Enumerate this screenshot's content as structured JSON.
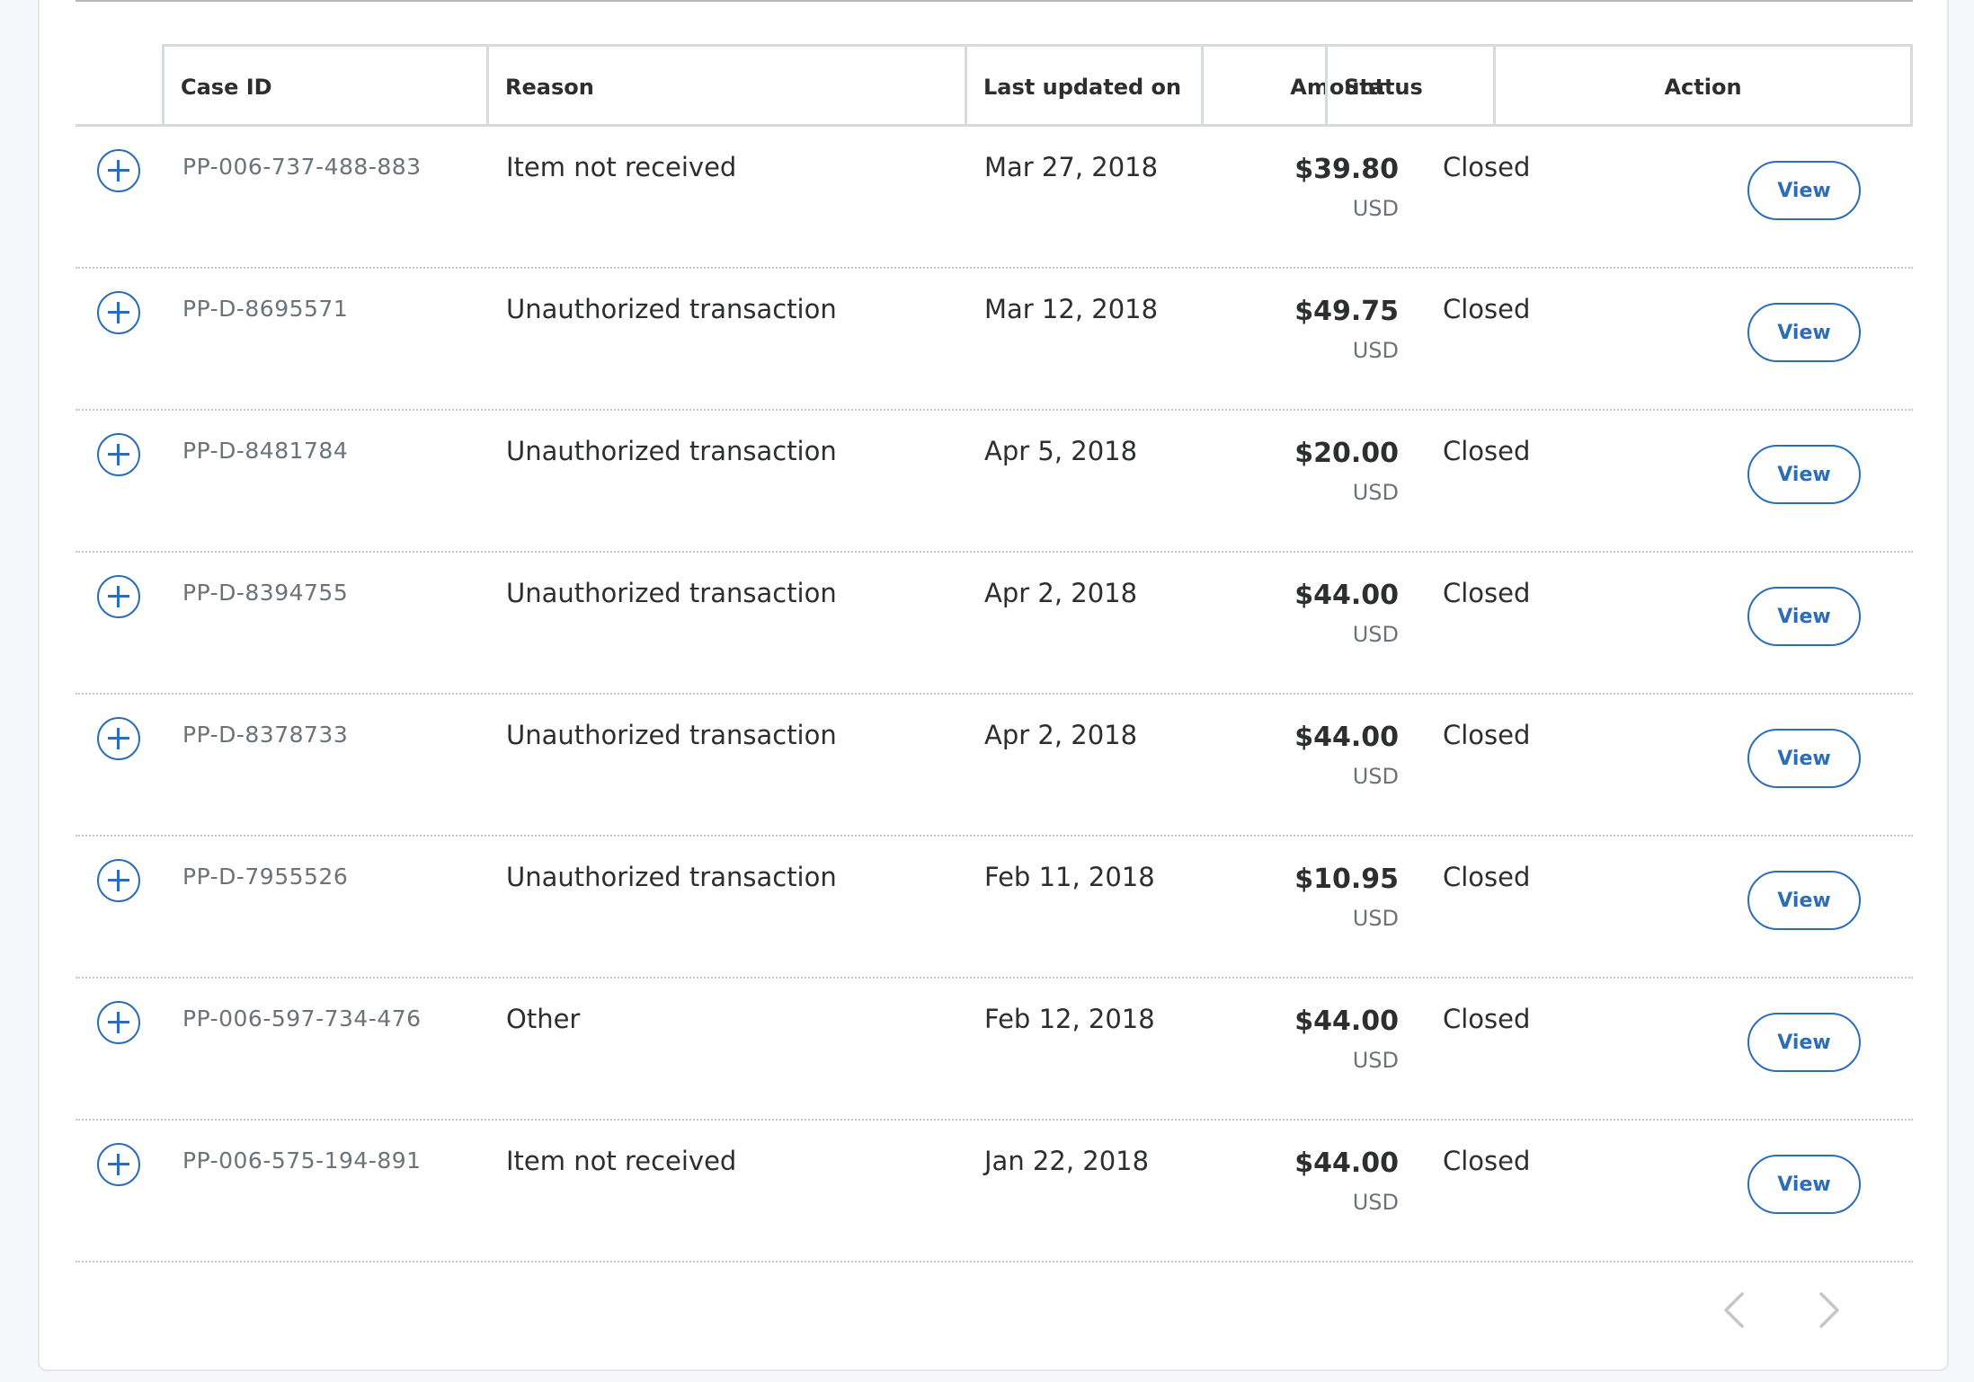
{
  "table": {
    "columns": {
      "case_id": "Case ID",
      "reason": "Reason",
      "last_updated": "Last updated on",
      "amount": "Amount",
      "status": "Status",
      "action": "Action"
    },
    "rows": [
      {
        "case_id": "PP-006-737-488-883",
        "reason": "Item not received",
        "last_updated": "Mar 27, 2018",
        "amount": "$39.80",
        "currency": "USD",
        "status": "Closed",
        "action_label": "View"
      },
      {
        "case_id": "PP-D-8695571",
        "reason": "Unauthorized transaction",
        "last_updated": "Mar 12, 2018",
        "amount": "$49.75",
        "currency": "USD",
        "status": "Closed",
        "action_label": "View"
      },
      {
        "case_id": "PP-D-8481784",
        "reason": "Unauthorized transaction",
        "last_updated": "Apr 5, 2018",
        "amount": "$20.00",
        "currency": "USD",
        "status": "Closed",
        "action_label": "View"
      },
      {
        "case_id": "PP-D-8394755",
        "reason": "Unauthorized transaction",
        "last_updated": "Apr 2, 2018",
        "amount": "$44.00",
        "currency": "USD",
        "status": "Closed",
        "action_label": "View"
      },
      {
        "case_id": "PP-D-8378733",
        "reason": "Unauthorized transaction",
        "last_updated": "Apr 2, 2018",
        "amount": "$44.00",
        "currency": "USD",
        "status": "Closed",
        "action_label": "View"
      },
      {
        "case_id": "PP-D-7955526",
        "reason": "Unauthorized transaction",
        "last_updated": "Feb 11, 2018",
        "amount": "$10.95",
        "currency": "USD",
        "status": "Closed",
        "action_label": "View"
      },
      {
        "case_id": "PP-006-597-734-476",
        "reason": "Other",
        "last_updated": "Feb 12, 2018",
        "amount": "$44.00",
        "currency": "USD",
        "status": "Closed",
        "action_label": "View"
      },
      {
        "case_id": "PP-006-575-194-891",
        "reason": "Item not received",
        "last_updated": "Jan 22, 2018",
        "amount": "$44.00",
        "currency": "USD",
        "status": "Closed",
        "action_label": "View"
      }
    ]
  },
  "pagination": {
    "prev_icon": "chevron-left-icon",
    "next_icon": "chevron-right-icon"
  },
  "colors": {
    "accent": "#2c6db8",
    "text_primary": "#2c2e2f",
    "text_secondary": "#6c7378",
    "page_background": "#f5f7fa"
  }
}
